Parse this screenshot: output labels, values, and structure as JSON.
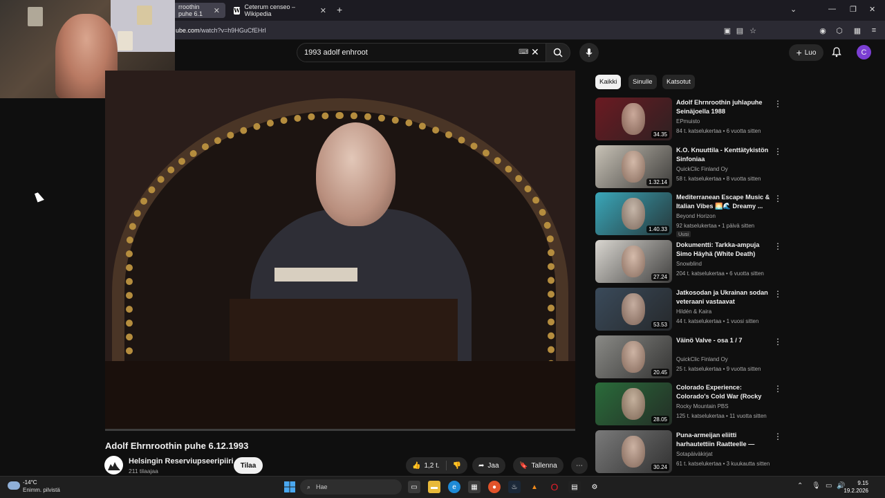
{
  "browser": {
    "tabs": [
      {
        "title": "rroothin puhe 6.1",
        "active": true
      },
      {
        "title": "Ceterum censeo – Wikipedia",
        "active": false
      }
    ],
    "url_prefix": "ube.com",
    "url_rest": "/watch?v=h9HGuCfEHrI"
  },
  "youtube": {
    "search_query": "1993 adolf enhroot",
    "create_label": "Luo",
    "avatar_letter": "C",
    "video": {
      "title": "Adolf Ehrnroothin puhe 6.12.1993",
      "channel": "Helsingin Reserviupseeripiiri",
      "subscribers": "211 tilaajaa",
      "subscribe_label": "Tilaa",
      "likes": "1,2 t.",
      "share_label": "Jaa",
      "save_label": "Tallenna",
      "progress": 0.0
    },
    "chips": [
      "Kaikki",
      "Sinulle",
      "Katsotut"
    ],
    "recommendations": [
      {
        "title": "Adolf Ehrnroothin juhlapuhe Seinäjoella 1988",
        "channel": "EPmuisto",
        "meta": "84 t. katselukertaa • 6 vuotta sitten",
        "duration": "34.35",
        "badge": "",
        "color": "#6b1a22"
      },
      {
        "title": "K.O. Knuuttila - Kenttätykistön Sinfoniaa",
        "channel": "QuickClic Finland Oy",
        "meta": "58 t. katselukertaa • 8 vuotta sitten",
        "duration": "1.32.14",
        "badge": "",
        "color": "#c8c2b6"
      },
      {
        "title": "Mediterranean Escape Music & Italian Vibes 🌅🌊 Dreamy ...",
        "channel": "Beyond Horizon",
        "meta": "92 katselukertaa • 1 päivä sitten",
        "duration": "1.40.33",
        "badge": "Uusi",
        "color": "#3aa6b8"
      },
      {
        "title": "Dokumentti: Tarkka-ampuja Simo Häyhä (White Death)",
        "channel": "Snowblind",
        "meta": "204 t. katselukertaa • 6 vuotta sitten",
        "duration": "27.24",
        "badge": "",
        "color": "#d9d6d0"
      },
      {
        "title": "Jatkosodan ja Ukrainan sodan veteraani vastaavat kysymyksi...",
        "channel": "Hildén & Kaira",
        "meta": "44 t. katselukertaa • 1 vuosi sitten",
        "duration": "53.53",
        "badge": "",
        "color": "#3a4a5a"
      },
      {
        "title": "Väinö Valve - osa 1 / 7",
        "channel": "QuickClic Finland Oy",
        "meta": "25 t. katselukertaa • 9 vuotta sitten",
        "duration": "20.45",
        "badge": "",
        "color": "#8a8a86"
      },
      {
        "title": "Colorado Experience: Colorado's Cold War (Rocky Flats)",
        "channel": "Rocky Mountain PBS",
        "meta": "125 t. katselukertaa • 11 vuotta sitten",
        "duration": "28.05",
        "badge": "",
        "color": "#2a6b3a"
      },
      {
        "title": "Puna-armeijan eliitti harhautettiin Raatteelle — ans...",
        "channel": "Sotapäiväkirjat",
        "meta": "61 t. katselukertaa • 3 kuukautta sitten",
        "duration": "30.24",
        "badge": "",
        "color": "#7a7a7a"
      }
    ]
  },
  "taskbar": {
    "temperature": "-14°C",
    "weather": "Enimm. pilvistä",
    "search_label": "Hae",
    "time": "9.15",
    "date": "19.2.2026"
  }
}
